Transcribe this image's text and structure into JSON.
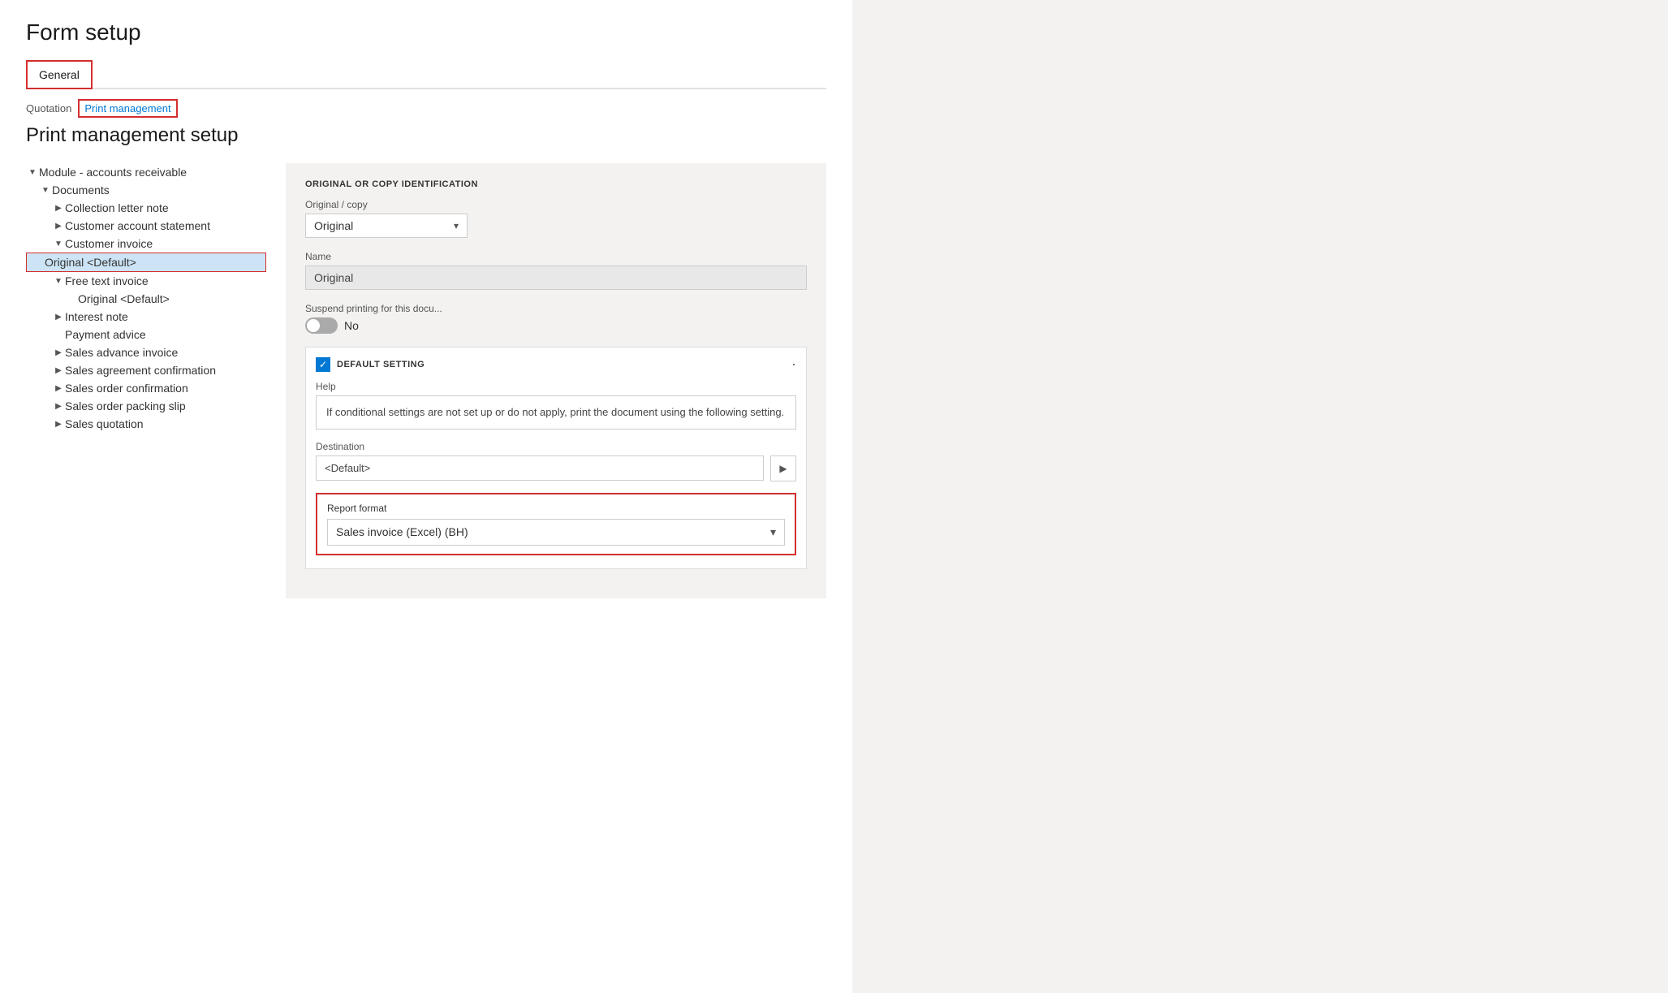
{
  "page": {
    "title": "Form setup"
  },
  "tabs": [
    {
      "id": "general",
      "label": "General",
      "active": true
    }
  ],
  "breadcrumb": {
    "quotation": "Quotation",
    "printManagement": "Print management"
  },
  "sectionTitle": "Print management setup",
  "tree": {
    "items": [
      {
        "id": "module",
        "label": "Module - accounts receivable",
        "indent": 0,
        "arrow": "▼"
      },
      {
        "id": "documents",
        "label": "Documents",
        "indent": 1,
        "arrow": "▼"
      },
      {
        "id": "collection-letter",
        "label": "Collection letter note",
        "indent": 2,
        "arrow": "▶"
      },
      {
        "id": "customer-account",
        "label": "Customer account statement",
        "indent": 2,
        "arrow": "▶"
      },
      {
        "id": "customer-invoice",
        "label": "Customer invoice",
        "indent": 2,
        "arrow": "▼"
      },
      {
        "id": "original-default",
        "label": "Original <Default>",
        "indent": 3,
        "arrow": "",
        "selected": true
      },
      {
        "id": "free-text-invoice",
        "label": "Free text invoice",
        "indent": 2,
        "arrow": "▼"
      },
      {
        "id": "original-default-2",
        "label": "Original <Default>",
        "indent": 3,
        "arrow": ""
      },
      {
        "id": "interest-note",
        "label": "Interest note",
        "indent": 2,
        "arrow": "▶"
      },
      {
        "id": "payment-advice",
        "label": "Payment advice",
        "indent": 2,
        "arrow": ""
      },
      {
        "id": "sales-advance-invoice",
        "label": "Sales advance invoice",
        "indent": 2,
        "arrow": "▶"
      },
      {
        "id": "sales-agreement",
        "label": "Sales agreement confirmation",
        "indent": 2,
        "arrow": "▶"
      },
      {
        "id": "sales-order-confirmation",
        "label": "Sales order confirmation",
        "indent": 2,
        "arrow": "▶"
      },
      {
        "id": "sales-order-packing",
        "label": "Sales order packing slip",
        "indent": 2,
        "arrow": "▶"
      },
      {
        "id": "sales-quotation",
        "label": "Sales quotation",
        "indent": 2,
        "arrow": "▶"
      }
    ]
  },
  "detailPanel": {
    "originalCopySection": {
      "heading": "ORIGINAL OR COPY IDENTIFICATION",
      "originalCopyLabel": "Original / copy",
      "originalCopyValue": "Original",
      "nameLabel": "Name",
      "nameValue": "Original",
      "suspendLabel": "Suspend printing for this docu...",
      "suspendValue": "No",
      "suspendToggleOn": false
    },
    "defaultSetting": {
      "heading": "DEFAULT SETTING",
      "checked": true,
      "help": {
        "label": "Help",
        "text": "If conditional settings are not set up or do not apply,\nprint the document using the following setting."
      },
      "destination": {
        "label": "Destination",
        "value": "<Default>",
        "buttonIcon": "▶"
      },
      "reportFormat": {
        "label": "Report format",
        "value": "Sales invoice (Excel) (BH)"
      }
    }
  },
  "icons": {
    "chevronDown": "▾",
    "chevronRight": "▸",
    "triangleDown": "▼",
    "triangleRight": "▶",
    "checkmark": "✓"
  }
}
